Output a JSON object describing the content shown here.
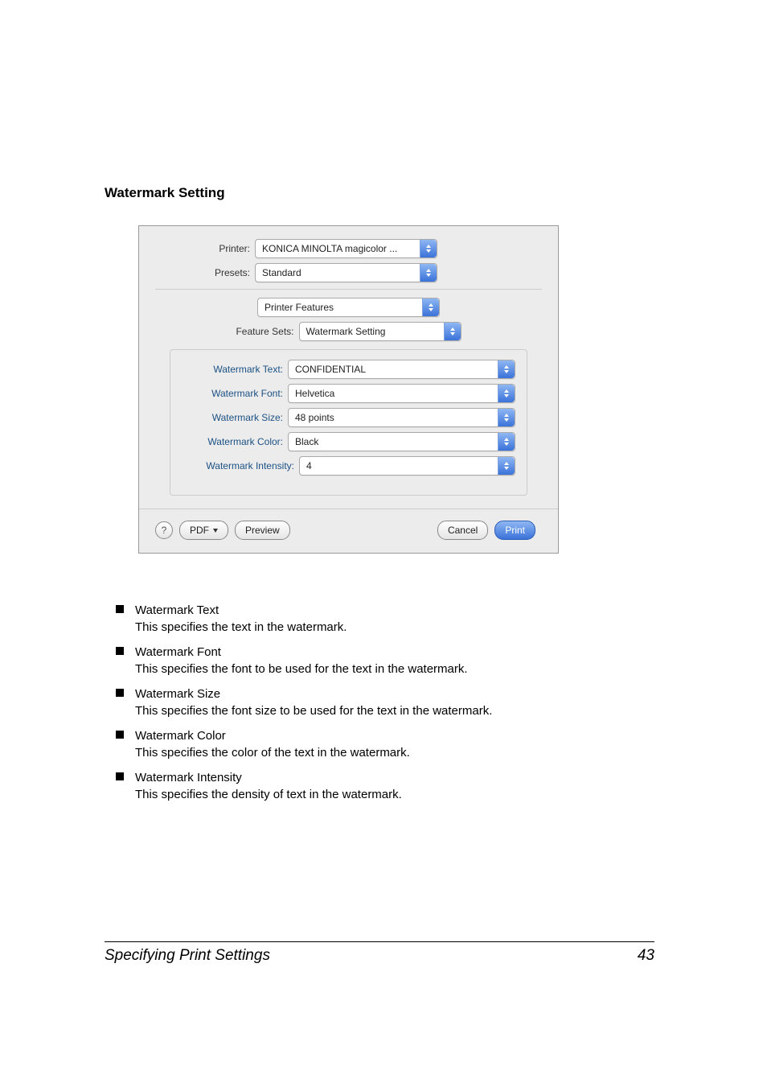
{
  "sectionTitle": "Watermark Setting",
  "dialog": {
    "printerLabel": "Printer:",
    "printerValue": "KONICA MINOLTA magicolor ...",
    "presetsLabel": "Presets:",
    "presetsValue": "Standard",
    "paneValue": "Printer Features",
    "featureSetsLabel": "Feature Sets:",
    "featureSetsValue": "Watermark Setting",
    "wm": {
      "textLabel": "Watermark Text:",
      "textValue": "CONFIDENTIAL",
      "fontLabel": "Watermark Font:",
      "fontValue": "Helvetica",
      "sizeLabel": "Watermark Size:",
      "sizeValue": "48 points",
      "colorLabel": "Watermark Color:",
      "colorValue": "Black",
      "intensityLabel": "Watermark Intensity:",
      "intensityValue": "4"
    },
    "help": "?",
    "pdf": "PDF",
    "preview": "Preview",
    "cancel": "Cancel",
    "print": "Print"
  },
  "bullets": [
    {
      "title": "Watermark Text",
      "desc": "This specifies the text in the watermark."
    },
    {
      "title": "Watermark Font",
      "desc": "This specifies the font to be used for the text in the watermark."
    },
    {
      "title": "Watermark Size",
      "desc": "This specifies the font size to be used for the text in the watermark."
    },
    {
      "title": "Watermark Color",
      "desc": "This specifies the color of the text in the watermark."
    },
    {
      "title": "Watermark Intensity",
      "desc": "This specifies the density of text in the watermark."
    }
  ],
  "footer": {
    "left": "Specifying Print Settings",
    "right": "43"
  }
}
